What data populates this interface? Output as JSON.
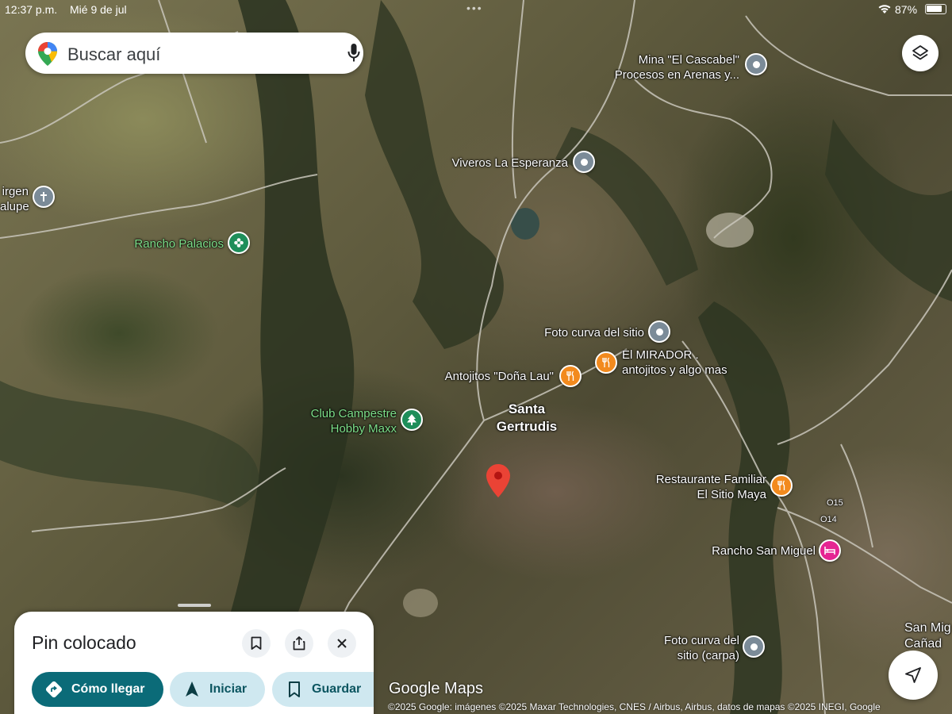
{
  "status_bar": {
    "time": "12:37 p.m.",
    "date": "Mié 9 de jul",
    "battery": "87%"
  },
  "search": {
    "placeholder": "Buscar aquí"
  },
  "places": {
    "mina": [
      "Mina \"El Cascabel\"",
      "Procesos en Arenas y..."
    ],
    "viveros": "Viveros La Esperanza",
    "virgen": [
      "irgen",
      "alupe"
    ],
    "rancho_palacios": "Rancho Palacios",
    "foto_curva": "Foto curva del sitio",
    "mirador": [
      "El MIRADOR .",
      "antojitos y algo mas"
    ],
    "antojitos": "Antojitos \"Doña Lau\"",
    "santa_gertrudis": [
      "Santa",
      "Gertrudis"
    ],
    "club": [
      "Club Campestre",
      "Hobby Maxx"
    ],
    "restaurante": [
      "Restaurante Familiar",
      "El Sitio Maya"
    ],
    "rancho_san_miguel": "Rancho San Miguel",
    "foto_curva_carpa": [
      "Foto curva del",
      "sitio (carpa)"
    ],
    "san_miguel_edge": [
      "San Mig",
      "Cañad"
    ],
    "road_015": "O15",
    "road_014": "O14"
  },
  "sheet": {
    "title": "Pin colocado",
    "directions": "Cómo llegar",
    "start": "Iniciar",
    "save": "Guardar"
  },
  "footer": {
    "logo": "Google Maps",
    "copyright": "©2025 Google: imágenes ©2025 Maxar Technologies, CNES / Airbus, Airbus, datos de mapas ©2025 INEGI, Google"
  },
  "icons": {
    "search_logo": "maps-pin-logo-icon",
    "mic": "mic-icon",
    "layers": "layers-icon",
    "bookmark": "bookmark-icon",
    "share": "share-icon",
    "close": "close-icon",
    "directions": "directions-icon",
    "navigate": "navigation-arrow-icon",
    "my_location": "my-location-icon"
  },
  "colors": {
    "primary_chip": "#0b6b78",
    "secondary_chip": "#cfe8f0",
    "pin": "#ea4335",
    "green_label": "#7ee08a"
  }
}
